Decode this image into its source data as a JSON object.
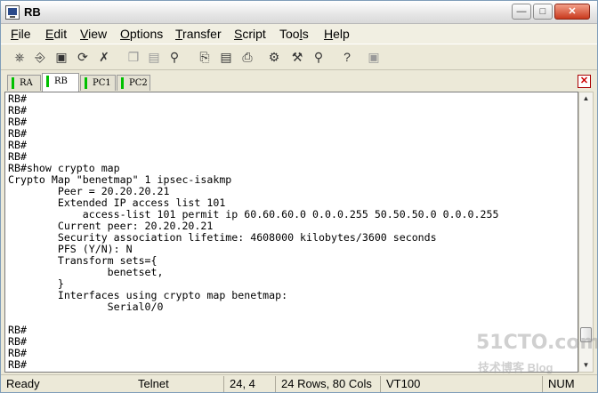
{
  "window": {
    "title": "RB"
  },
  "menu": [
    "File",
    "Edit",
    "View",
    "Options",
    "Transfer",
    "Script",
    "Tools",
    "Help"
  ],
  "menu_underline": [
    "F",
    "E",
    "V",
    "O",
    "T",
    "S",
    "l",
    "H"
  ],
  "tabs": [
    "RA",
    "RB",
    "PC1",
    "PC2"
  ],
  "active_tab": "RB",
  "terminal_lines": [
    "RB#",
    "RB#",
    "RB#",
    "RB#",
    "RB#",
    "RB#",
    "RB#show crypto map",
    "Crypto Map \"benetmap\" 1 ipsec-isakmp",
    "        Peer = 20.20.20.21",
    "        Extended IP access list 101",
    "            access-list 101 permit ip 60.60.60.0 0.0.0.255 50.50.50.0 0.0.0.255",
    "        Current peer: 20.20.20.21",
    "        Security association lifetime: 4608000 kilobytes/3600 seconds",
    "        PFS (Y/N): N",
    "        Transform sets={",
    "                benetset,",
    "        }",
    "        Interfaces using crypto map benetmap:",
    "                Serial0/0",
    "",
    "RB#",
    "RB#",
    "RB#",
    "RB#"
  ],
  "status": {
    "state": "Ready",
    "protocol": "Telnet",
    "cursor": "24,  4",
    "size": "24 Rows, 80 Cols",
    "emulation": "VT100",
    "num": "NUM"
  },
  "watermark": {
    "line1": "51CTO.com",
    "line2": "技术博客  Blog"
  }
}
